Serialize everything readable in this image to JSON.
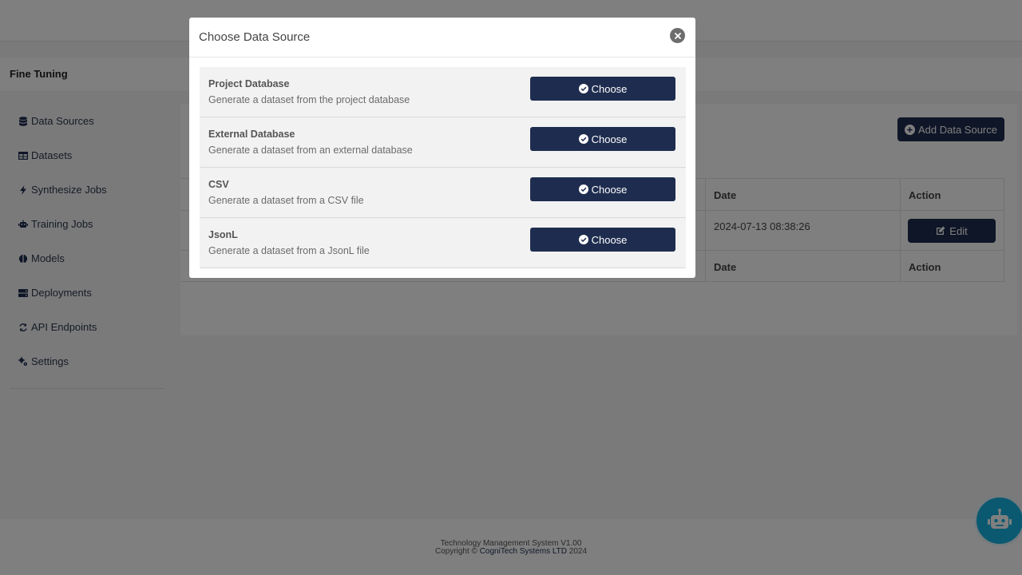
{
  "app": {
    "section_title": "Fine Tuning",
    "sidebar": {
      "items": [
        {
          "label": "Data Sources",
          "icon": "database-icon"
        },
        {
          "label": "Datasets",
          "icon": "table-icon"
        },
        {
          "label": "Synthesize Jobs",
          "icon": "bolt-icon"
        },
        {
          "label": "Training Jobs",
          "icon": "robot-icon"
        },
        {
          "label": "Models",
          "icon": "brain-icon"
        },
        {
          "label": "Deployments",
          "icon": "server-icon"
        },
        {
          "label": "API Endpoints",
          "icon": "sync-icon"
        },
        {
          "label": "Settings",
          "icon": "cogs-icon"
        }
      ]
    },
    "main": {
      "add_button_label": "Add Data Source",
      "table": {
        "header": {
          "date": "Date",
          "action": "Action"
        },
        "rows": [
          {
            "date": "2024-07-13 08:38:26",
            "action_label": "Edit"
          }
        ],
        "footer": {
          "date": "Date",
          "action": "Action"
        }
      }
    },
    "footer": {
      "line1": "Technology Management System V1.00",
      "copyright_prefix": "Copyright ©",
      "company": "CogniTech Systems LTD",
      "year": "2024"
    }
  },
  "modal": {
    "title": "Choose Data Source",
    "options": [
      {
        "name": "Project Database",
        "description": "Generate a dataset from the project database",
        "button": "Choose"
      },
      {
        "name": "External Database",
        "description": "Generate a dataset from an external database",
        "button": "Choose"
      },
      {
        "name": "CSV",
        "description": "Generate a dataset from a CSV file",
        "button": "Choose"
      },
      {
        "name": "JsonL",
        "description": "Generate a dataset from a JsonL file",
        "button": "Choose"
      }
    ]
  },
  "colors": {
    "primary": "#1e2d4f",
    "chatbot": "#16b3e0",
    "overlay": "rgba(0,0,0,0.5)"
  }
}
